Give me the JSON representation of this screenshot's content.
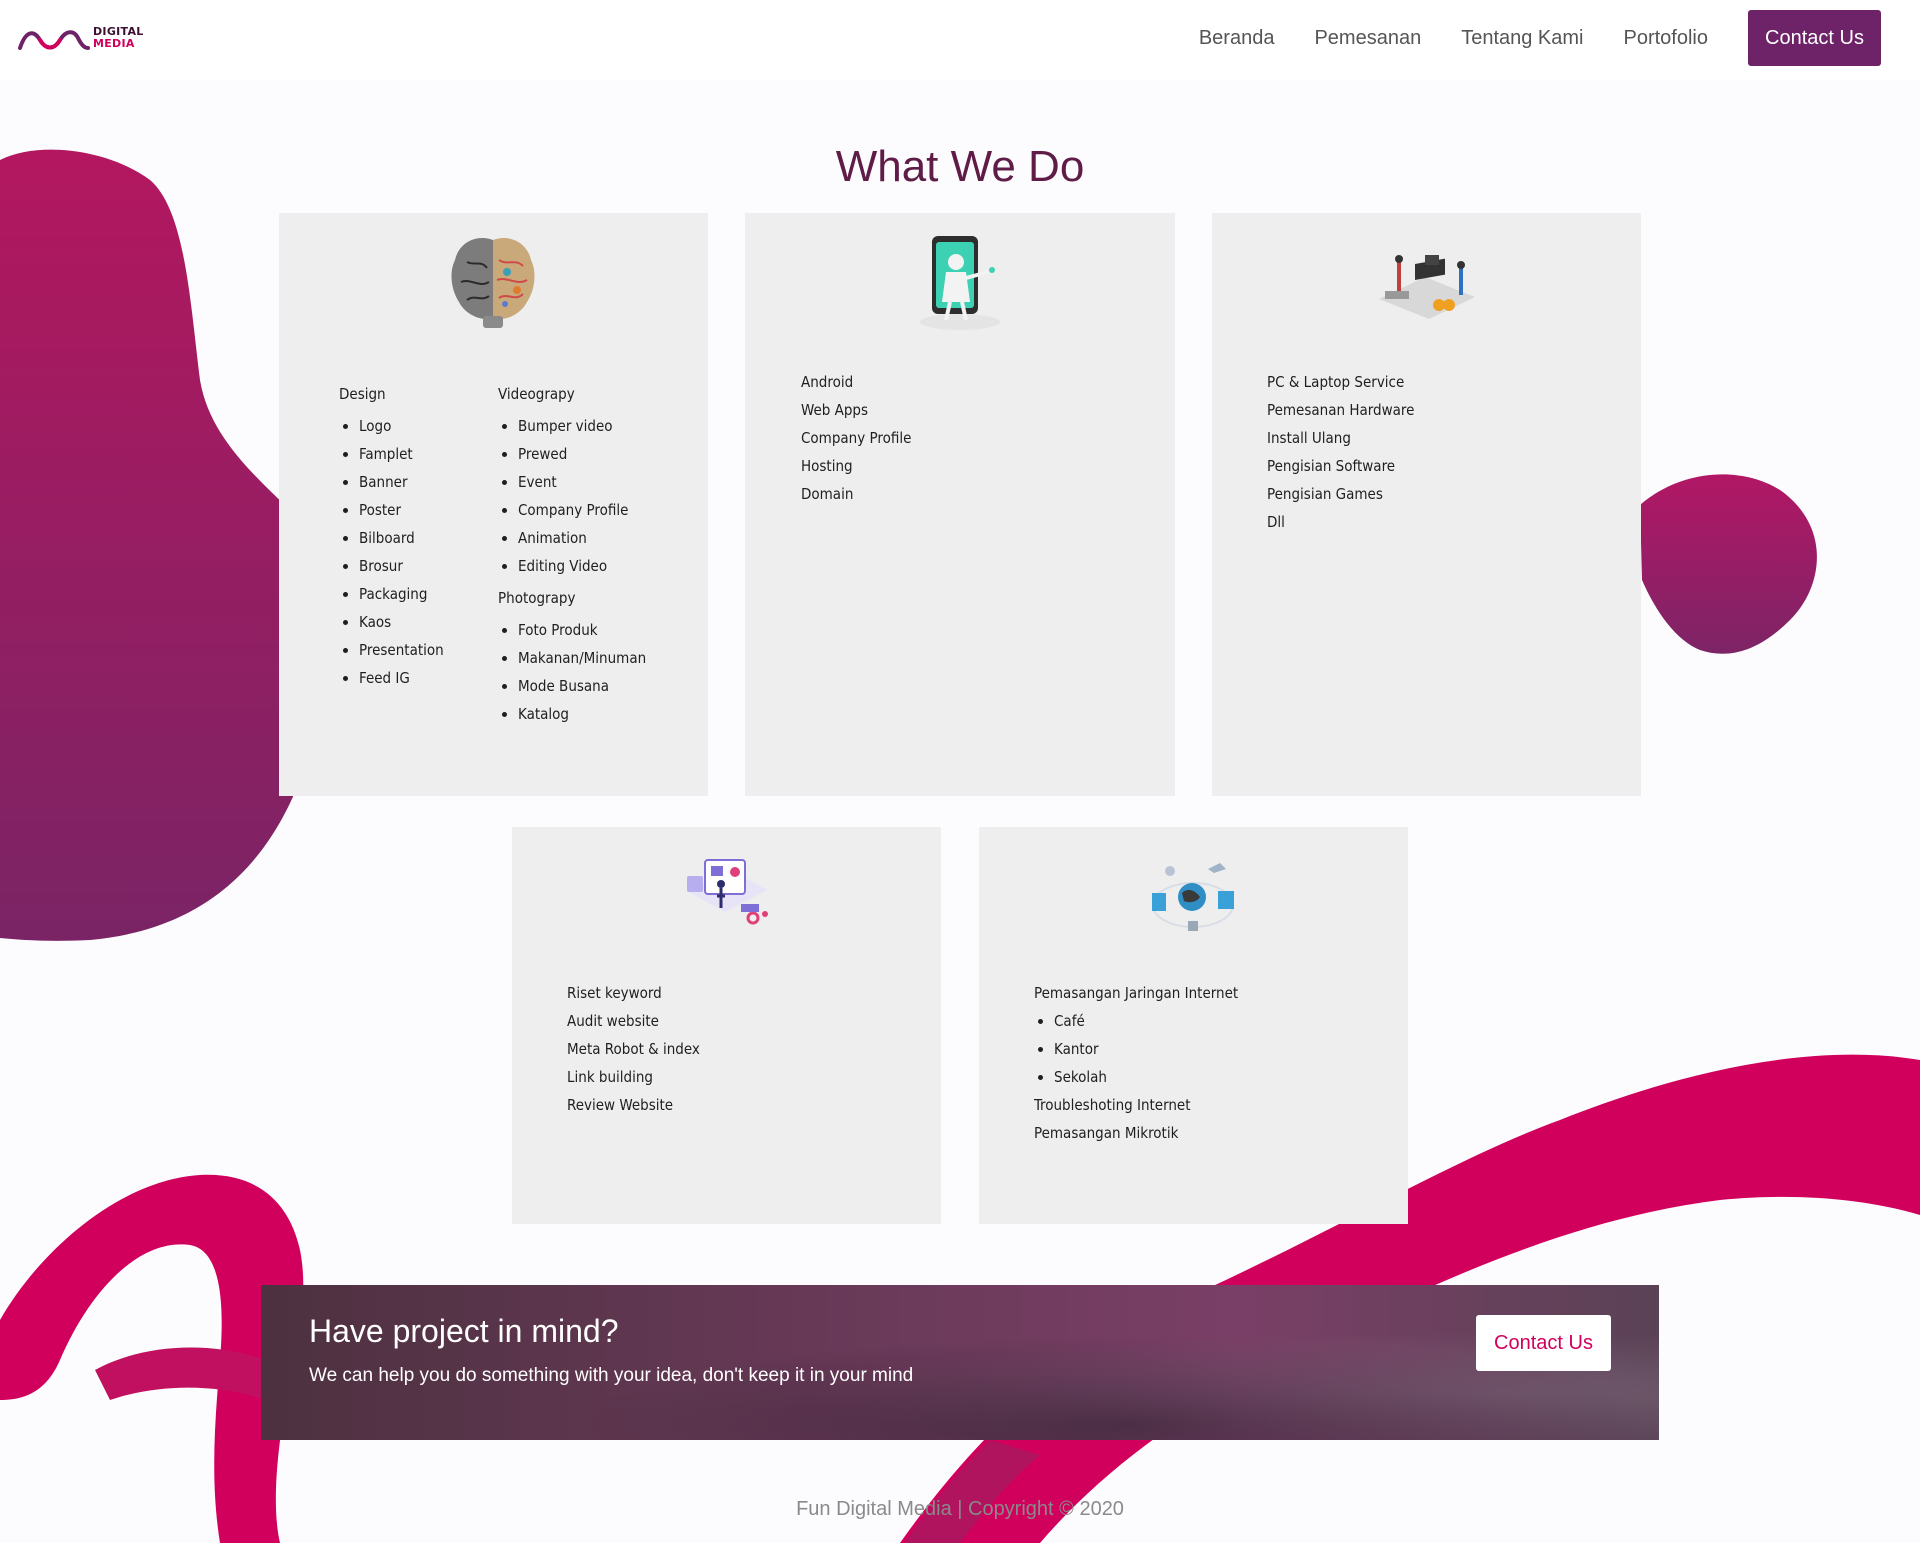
{
  "brand": {
    "line1": "DIGITAL",
    "line2": "MEDIA",
    "logo_icon": "wave-logo-icon"
  },
  "nav": {
    "items": [
      "Beranda",
      "Pemesanan",
      "Tentang Kami",
      "Portofolio"
    ],
    "contact_label": "Contact Us"
  },
  "section": {
    "title": "What We Do"
  },
  "cards": {
    "design": {
      "icon": "brain-illustration-icon",
      "heading": "Design",
      "items": [
        "Logo",
        "Famplet",
        "Banner",
        "Poster",
        "Bilboard",
        "Brosur",
        "Packaging",
        "Kaos",
        "Presentation",
        "Feed IG"
      ],
      "videography_heading": "Videograpy",
      "videography_items": [
        "Bumper video",
        "Prewed",
        "Event",
        "Company Profile",
        "Animation",
        "Editing Video"
      ],
      "photography_heading": "Photograpy",
      "photography_items": [
        "Foto Produk",
        "Makanan/Minuman",
        "Mode Busana",
        "Katalog"
      ]
    },
    "web": {
      "icon": "mobile-robot-illustration-icon",
      "items": [
        "Android",
        "Web Apps",
        "Company Profile",
        "Hosting",
        "Domain"
      ]
    },
    "service": {
      "icon": "hardware-service-illustration-icon",
      "items": [
        "PC & Laptop Service",
        "Pemesanan Hardware",
        "Install Ulang",
        "Pengisian Software",
        "Pengisian Games",
        "Dll"
      ]
    },
    "seo": {
      "icon": "seo-dashboard-illustration-icon",
      "items": [
        "Riset keyword",
        "Audit website",
        "Meta Robot & index",
        "Link building",
        "Review Website"
      ]
    },
    "network": {
      "icon": "globe-network-illustration-icon",
      "heading": "Pemasangan Jaringan Internet",
      "items": [
        "Café",
        "Kantor",
        "Sekolah"
      ],
      "after": [
        "Troubleshoting Internet",
        "Pemasangan Mikrotik"
      ]
    }
  },
  "cta": {
    "title": "Have project in mind?",
    "subtitle": "We can help you do something with your idea, don't keep it in your mind",
    "button_label": "Contact Us"
  },
  "footer": {
    "text": "Fun Digital Media | Copyright © 2020"
  },
  "colors": {
    "primary": "#6e2369",
    "accent": "#d1005d",
    "title": "#5e1c46",
    "card": "#eeeeee"
  }
}
